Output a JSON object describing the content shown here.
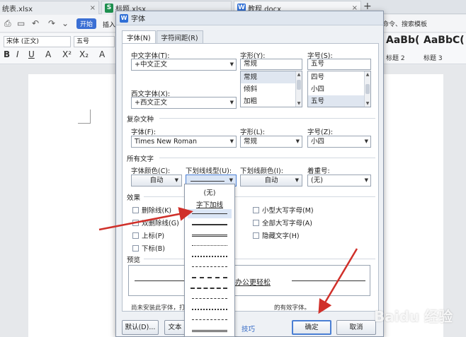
{
  "tabs": [
    {
      "label": "统表.xlsx",
      "icon": "xlsx-icon",
      "color": "#1d8f4e"
    },
    {
      "label": "标题.xlsx",
      "icon": "xlsx-icon",
      "color": "#1d8f4e"
    },
    {
      "label": "教程.docx",
      "icon": "docx-icon",
      "color": "#2f6fd6"
    }
  ],
  "ribbon": {
    "start": "开始",
    "insert": "插入",
    "search_template": "命令、搜索模板",
    "font_name": "宋体 (正文)",
    "font_size": "五号",
    "style1_sample": "AaBb(",
    "style2_sample": "AaBbC(",
    "style1_label": "标题 2",
    "style2_label": "标题 3"
  },
  "dialog": {
    "title": "字体",
    "tab_font": "字体(N)",
    "tab_spacing": "字符间距(R)",
    "cn_font_label": "中文字体(T):",
    "cn_font_value": "+中文正文",
    "style_label": "字形(Y):",
    "style_value": "常规",
    "style_options": [
      "常规",
      "倾斜",
      "加粗"
    ],
    "size_label": "字号(S):",
    "size_value": "五号",
    "size_options": [
      "四号",
      "小四",
      "五号"
    ],
    "west_font_label": "西文字体(X):",
    "west_font_value": "+西文正文",
    "complex_section": "复杂文种",
    "complex_font_label": "字体(F):",
    "complex_font_value": "Times New Roman",
    "complex_style_label": "字形(L):",
    "complex_style_value": "常规",
    "complex_size_label": "字号(Z):",
    "complex_size_value": "小四",
    "all_text_section": "所有文字",
    "color_label": "字体颜色(C):",
    "color_value": "自动",
    "underline_type_label": "下划线线型(U):",
    "underline_color_label": "下划线颜色(I):",
    "underline_color_value": "自动",
    "emphasis_label": "着重号:",
    "emphasis_value": "(无)",
    "effects_section": "效果",
    "effects_left": [
      "删除线(K)",
      "双删除线(G)",
      "上标(P)",
      "下标(B)"
    ],
    "effects_right": [
      "小型大写字母(M)",
      "全部大写字母(A)",
      "隐藏文字(H)"
    ],
    "preview_section": "预览",
    "preview_text": "让办公更轻松",
    "note_left": "尚未安装此字体，打",
    "note_right": "的有效字体。",
    "default_btn": "默认(D)...",
    "text_effect_btn": "文本效",
    "tips_link": "技巧",
    "ok_btn": "确定",
    "cancel_btn": "取消"
  },
  "underline_dropdown": {
    "none": "(无)",
    "words_only": "字下加线"
  },
  "watermark": "Baidu 经验"
}
